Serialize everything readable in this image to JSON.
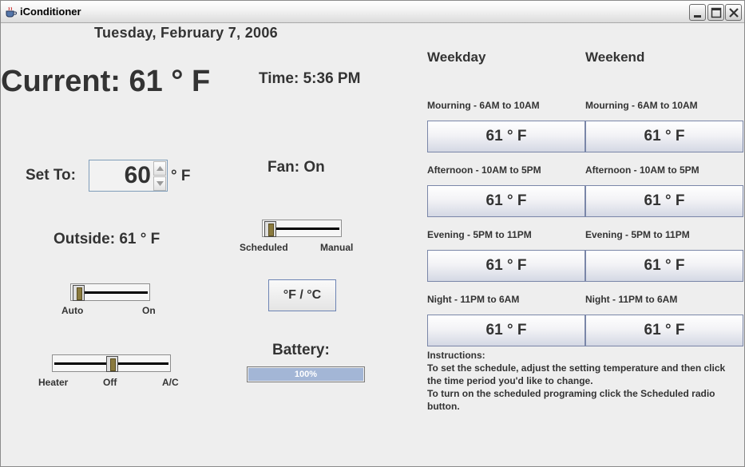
{
  "window": {
    "title": "iConditioner"
  },
  "date": "Tuesday, February 7, 2006",
  "current": {
    "text": "Current:  61 ° F"
  },
  "time": {
    "text": "Time:  5:36 PM"
  },
  "set_to": {
    "label": "Set To:",
    "value": "60",
    "unit": "° F"
  },
  "fan": {
    "text": "Fan:  On"
  },
  "mode_slider": {
    "left_label": "Scheduled",
    "right_label": "Manual",
    "selected": "Scheduled"
  },
  "outside": {
    "text": "Outside:  61 ° F"
  },
  "unit_toggle": {
    "label": "°F / °C"
  },
  "fan_slider": {
    "left_label": "Auto",
    "right_label": "On",
    "selected": "Auto"
  },
  "hvac_slider": {
    "left_label": "Heater",
    "mid_label": "Off",
    "right_label": "A/C",
    "selected": "Off"
  },
  "battery": {
    "label": "Battery:",
    "percent_text": "100%",
    "level": 1.0
  },
  "schedule": {
    "weekday_title": "Weekday",
    "weekend_title": "Weekend",
    "periods": [
      {
        "label": "Mourning - 6AM to 10AM",
        "weekday": "61 ° F",
        "weekend": "61 ° F"
      },
      {
        "label": "Afternoon - 10AM to 5PM",
        "weekday": "61 ° F",
        "weekend": "61 ° F"
      },
      {
        "label": "Evening - 5PM to 11PM",
        "weekday": "61 ° F",
        "weekend": "61 ° F"
      },
      {
        "label": "Night - 11PM to 6AM",
        "weekday": "61 ° F",
        "weekend": "61 ° F"
      }
    ]
  },
  "instructions": {
    "lines": [
      "Instructions:",
      "To set the schedule, adjust the setting temperature and then click",
      "the time period you'd like to change.",
      "To turn on the scheduled programing click the Scheduled radio",
      "button."
    ]
  },
  "icons": {
    "app": "coffee-cup-icon",
    "minimize": "minimize-icon",
    "maximize": "maximize-icon",
    "close": "close-icon"
  }
}
